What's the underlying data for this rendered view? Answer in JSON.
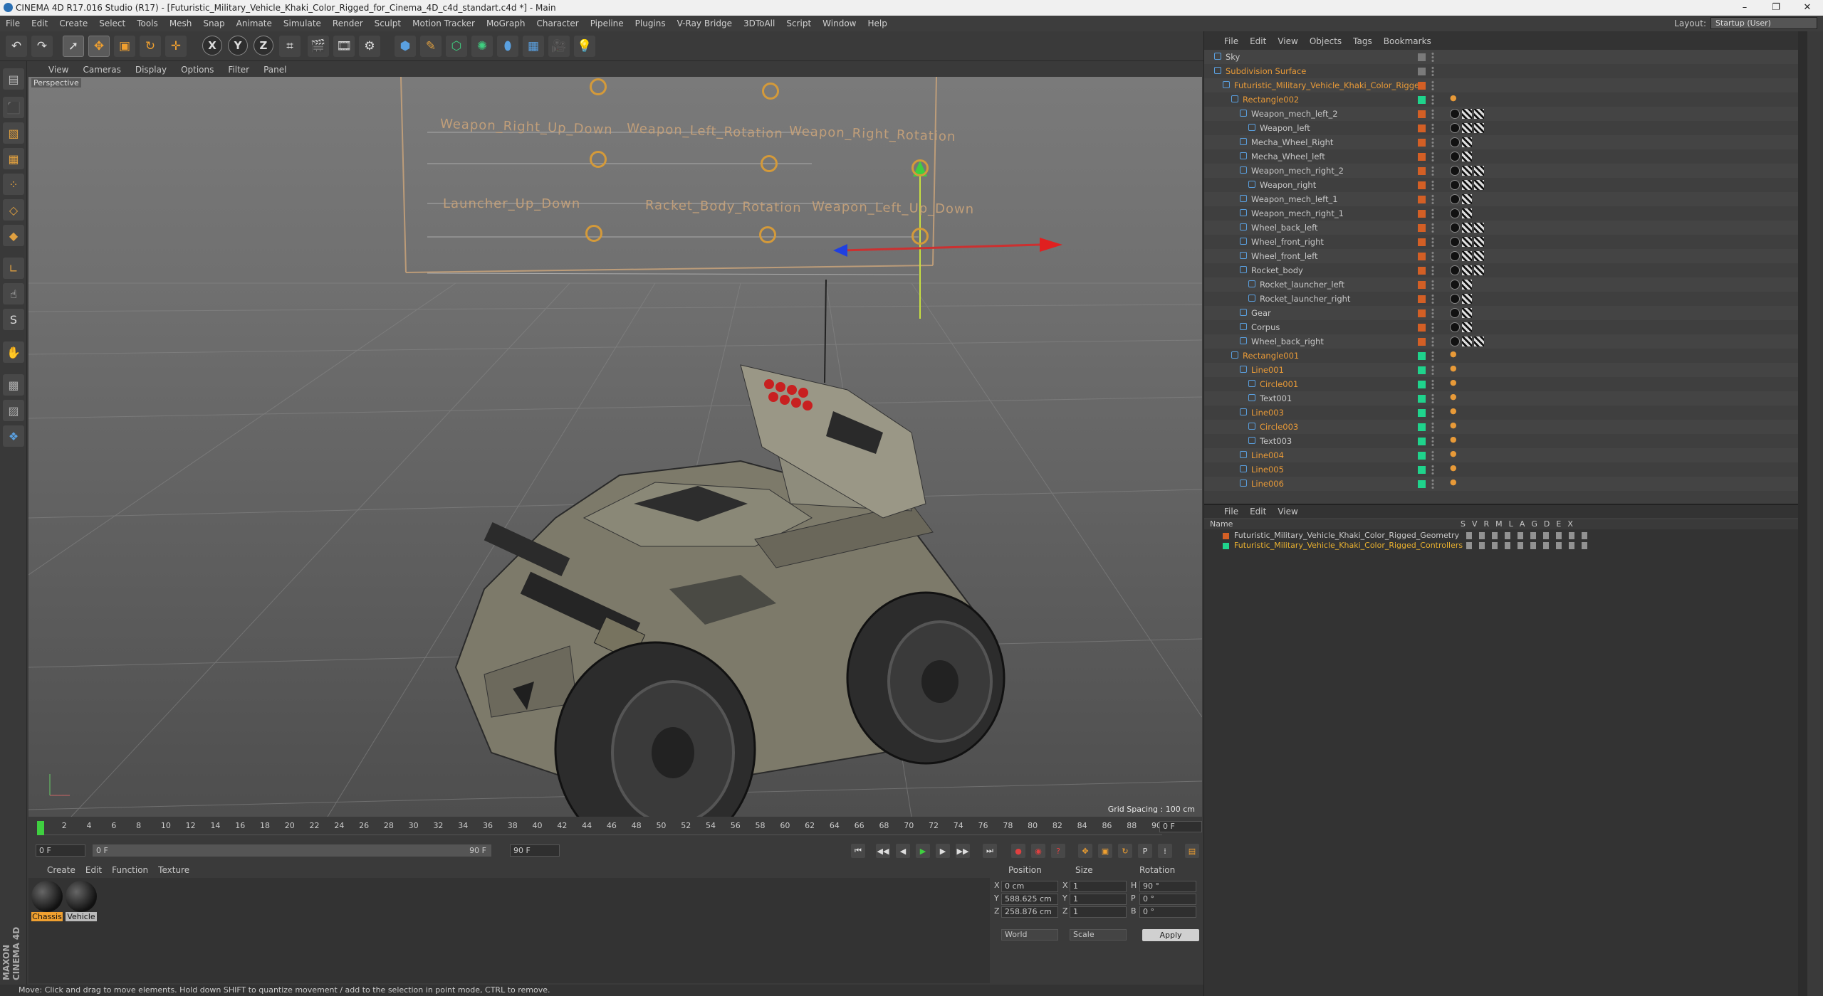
{
  "window": {
    "title": "CINEMA 4D R17.016 Studio (R17) - [Futuristic_Military_Vehicle_Khaki_Color_Rigged_for_Cinema_4D_c4d_standart.c4d *] - Main",
    "min": "–",
    "max": "❐",
    "close": "✕"
  },
  "menu": [
    "File",
    "Edit",
    "Create",
    "Select",
    "Tools",
    "Mesh",
    "Snap",
    "Animate",
    "Simulate",
    "Render",
    "Sculpt",
    "Motion Tracker",
    "MoGraph",
    "Character",
    "Pipeline",
    "Plugins",
    "V-Ray Bridge",
    "3DToAll",
    "Script",
    "Window",
    "Help"
  ],
  "layout": {
    "label": "Layout:",
    "value": "Startup (User)"
  },
  "viewport": {
    "menu": [
      "View",
      "Cameras",
      "Display",
      "Options",
      "Filter",
      "Panel"
    ],
    "camera_label": "Perspective",
    "grid_spacing": "Grid Spacing : 100 cm",
    "rig_labels": [
      "Weapon_Right_Up_Down",
      "Weapon_Left_Rotation",
      "Weapon_Right_Rotation",
      "Launcher_Up_Down",
      "Racket_Body_Rotation",
      "Weapon_Left_Up_Down"
    ]
  },
  "timeline": {
    "ticks": [
      "0",
      "2",
      "4",
      "6",
      "8",
      "10",
      "12",
      "14",
      "16",
      "18",
      "20",
      "22",
      "24",
      "26",
      "28",
      "30",
      "32",
      "34",
      "36",
      "38",
      "40",
      "42",
      "44",
      "46",
      "48",
      "50",
      "52",
      "54",
      "56",
      "58",
      "60",
      "62",
      "64",
      "66",
      "68",
      "70",
      "72",
      "74",
      "76",
      "78",
      "80",
      "82",
      "84",
      "86",
      "88",
      "90"
    ],
    "current_frame": "0 F",
    "start": "0 F",
    "range_start": "0 F",
    "range_end": "90 F",
    "end": "90 F"
  },
  "materials": {
    "menu": [
      "Create",
      "Edit",
      "Function",
      "Texture"
    ],
    "items": [
      "Chassis",
      "Vehicle"
    ]
  },
  "coords": {
    "headers": [
      "Position",
      "Size",
      "Rotation"
    ],
    "rows": [
      {
        "axis": "X",
        "pos": "0 cm",
        "size_axis": "X",
        "size": "1",
        "rot_axis": "H",
        "rot": "90 °"
      },
      {
        "axis": "Y",
        "pos": "588.625 cm",
        "size_axis": "Y",
        "size": "1",
        "rot_axis": "P",
        "rot": "0 °"
      },
      {
        "axis": "Z",
        "pos": "258.876 cm",
        "size_axis": "Z",
        "size": "1",
        "rot_axis": "B",
        "rot": "0 °"
      }
    ],
    "mode": "World",
    "scale": "Scale",
    "apply": "Apply"
  },
  "status": "Move: Click and drag to move elements. Hold down SHIFT to quantize movement / add to the selection in point mode, CTRL to remove.",
  "objects": {
    "menu": [
      "File",
      "Edit",
      "View",
      "Objects",
      "Tags",
      "Bookmarks"
    ],
    "items": [
      {
        "name": "Sky",
        "indent": 0,
        "orange": false,
        "color": "#7a7a7a",
        "tags": ""
      },
      {
        "name": "Subdivision Surface",
        "indent": 0,
        "orange": true,
        "color": "#7a7a7a",
        "tags": ""
      },
      {
        "name": "Futuristic_Military_Vehicle_Khaki_Color_Rigged",
        "indent": 1,
        "orange": true,
        "color": "#d35f25",
        "tags": ""
      },
      {
        "name": "Rectangle002",
        "indent": 2,
        "orange": true,
        "color": "#1fd38c",
        "tags": "d"
      },
      {
        "name": "Weapon_mech_left_2",
        "indent": 3,
        "orange": false,
        "color": "#d35f25",
        "tags": "mbb"
      },
      {
        "name": "Weapon_left",
        "indent": 4,
        "orange": false,
        "color": "#d35f25",
        "tags": "mbb"
      },
      {
        "name": "Mecha_Wheel_Right",
        "indent": 3,
        "orange": false,
        "color": "#d35f25",
        "tags": "mb"
      },
      {
        "name": "Mecha_Wheel_left",
        "indent": 3,
        "orange": false,
        "color": "#d35f25",
        "tags": "mb"
      },
      {
        "name": "Weapon_mech_right_2",
        "indent": 3,
        "orange": false,
        "color": "#d35f25",
        "tags": "mbb"
      },
      {
        "name": "Weapon_right",
        "indent": 4,
        "orange": false,
        "color": "#d35f25",
        "tags": "mbb"
      },
      {
        "name": "Weapon_mech_left_1",
        "indent": 3,
        "orange": false,
        "color": "#d35f25",
        "tags": "mb"
      },
      {
        "name": "Weapon_mech_right_1",
        "indent": 3,
        "orange": false,
        "color": "#d35f25",
        "tags": "mb"
      },
      {
        "name": "Wheel_back_left",
        "indent": 3,
        "orange": false,
        "color": "#d35f25",
        "tags": "mbb"
      },
      {
        "name": "Wheel_front_right",
        "indent": 3,
        "orange": false,
        "color": "#d35f25",
        "tags": "mbb"
      },
      {
        "name": "Wheel_front_left",
        "indent": 3,
        "orange": false,
        "color": "#d35f25",
        "tags": "mbb"
      },
      {
        "name": "Rocket_body",
        "indent": 3,
        "orange": false,
        "color": "#d35f25",
        "tags": "mbb"
      },
      {
        "name": "Rocket_launcher_left",
        "indent": 4,
        "orange": false,
        "color": "#d35f25",
        "tags": "mb"
      },
      {
        "name": "Rocket_launcher_right",
        "indent": 4,
        "orange": false,
        "color": "#d35f25",
        "tags": "mb"
      },
      {
        "name": "Gear",
        "indent": 3,
        "orange": false,
        "color": "#d35f25",
        "tags": "mb"
      },
      {
        "name": "Corpus",
        "indent": 3,
        "orange": false,
        "color": "#d35f25",
        "tags": "mb"
      },
      {
        "name": "Wheel_back_right",
        "indent": 3,
        "orange": false,
        "color": "#d35f25",
        "tags": "mbb"
      },
      {
        "name": "Rectangle001",
        "indent": 2,
        "orange": true,
        "color": "#1fd38c",
        "tags": "d"
      },
      {
        "name": "Line001",
        "indent": 3,
        "orange": true,
        "color": "#1fd38c",
        "tags": "d"
      },
      {
        "name": "Circle001",
        "indent": 4,
        "orange": true,
        "color": "#1fd38c",
        "tags": "d"
      },
      {
        "name": "Text001",
        "indent": 4,
        "orange": false,
        "color": "#1fd38c",
        "tags": "d"
      },
      {
        "name": "Line003",
        "indent": 3,
        "orange": true,
        "color": "#1fd38c",
        "tags": "d"
      },
      {
        "name": "Circle003",
        "indent": 4,
        "orange": true,
        "color": "#1fd38c",
        "tags": "d"
      },
      {
        "name": "Text003",
        "indent": 4,
        "orange": false,
        "color": "#1fd38c",
        "tags": "d"
      },
      {
        "name": "Line004",
        "indent": 3,
        "orange": true,
        "color": "#1fd38c",
        "tags": "d"
      },
      {
        "name": "Line005",
        "indent": 3,
        "orange": true,
        "color": "#1fd38c",
        "tags": "d"
      },
      {
        "name": "Line006",
        "indent": 3,
        "orange": true,
        "color": "#1fd38c",
        "tags": "d"
      }
    ]
  },
  "layers": {
    "menu": [
      "File",
      "Edit",
      "View"
    ],
    "name_header": "Name",
    "columns": [
      "S",
      "V",
      "R",
      "M",
      "L",
      "A",
      "G",
      "D",
      "E",
      "X"
    ],
    "items": [
      {
        "name": "Futuristic_Military_Vehicle_Khaki_Color_Rigged_Geometry",
        "color": "#d35f25",
        "orange": false
      },
      {
        "name": "Futuristic_Military_Vehicle_Khaki_Color_Rigged_Controllers",
        "color": "#1fd38c",
        "orange": true
      }
    ]
  },
  "maxon": "MAXON CINEMA 4D"
}
